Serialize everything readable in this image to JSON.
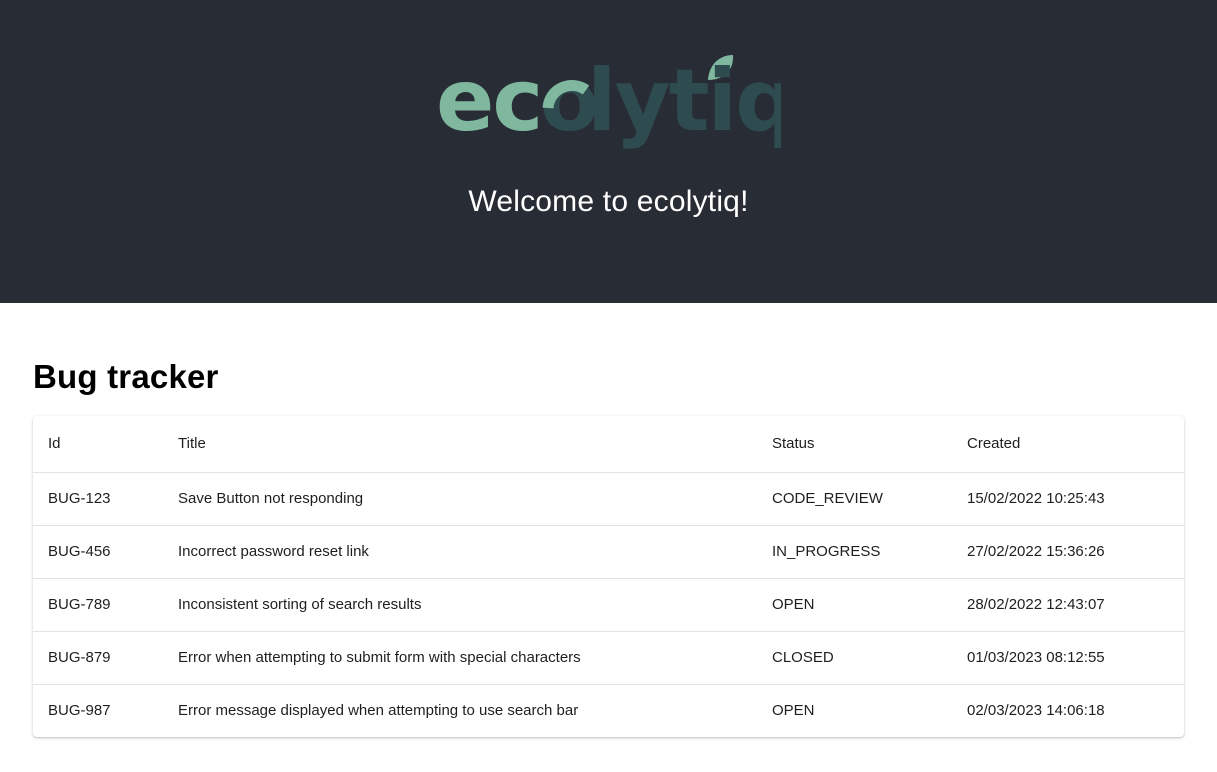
{
  "brand": {
    "logo_text": "ecolytiq",
    "logo_colors": {
      "eco": "#7fb89e",
      "lytiq": "#2e4b50",
      "leaf": "#7fb89e"
    }
  },
  "hero": {
    "welcome": "Welcome to ecolytiq!",
    "background": "#282c35"
  },
  "page": {
    "title": "Bug tracker"
  },
  "table": {
    "columns": {
      "id": "Id",
      "title": "Title",
      "status": "Status",
      "created": "Created"
    },
    "rows": [
      {
        "id": "BUG-123",
        "title": "Save Button not responding",
        "status": "CODE_REVIEW",
        "created": "15/02/2022 10:25:43"
      },
      {
        "id": "BUG-456",
        "title": "Incorrect password reset link",
        "status": "IN_PROGRESS",
        "created": "27/02/2022 15:36:26"
      },
      {
        "id": "BUG-789",
        "title": "Inconsistent sorting of search results",
        "status": "OPEN",
        "created": "28/02/2022 12:43:07"
      },
      {
        "id": "BUG-879",
        "title": "Error when attempting to submit form with special characters",
        "status": "CLOSED",
        "created": "01/03/2023 08:12:55"
      },
      {
        "id": "BUG-987",
        "title": "Error message displayed when attempting to use search bar",
        "status": "OPEN",
        "created": "02/03/2023 14:06:18"
      }
    ]
  }
}
